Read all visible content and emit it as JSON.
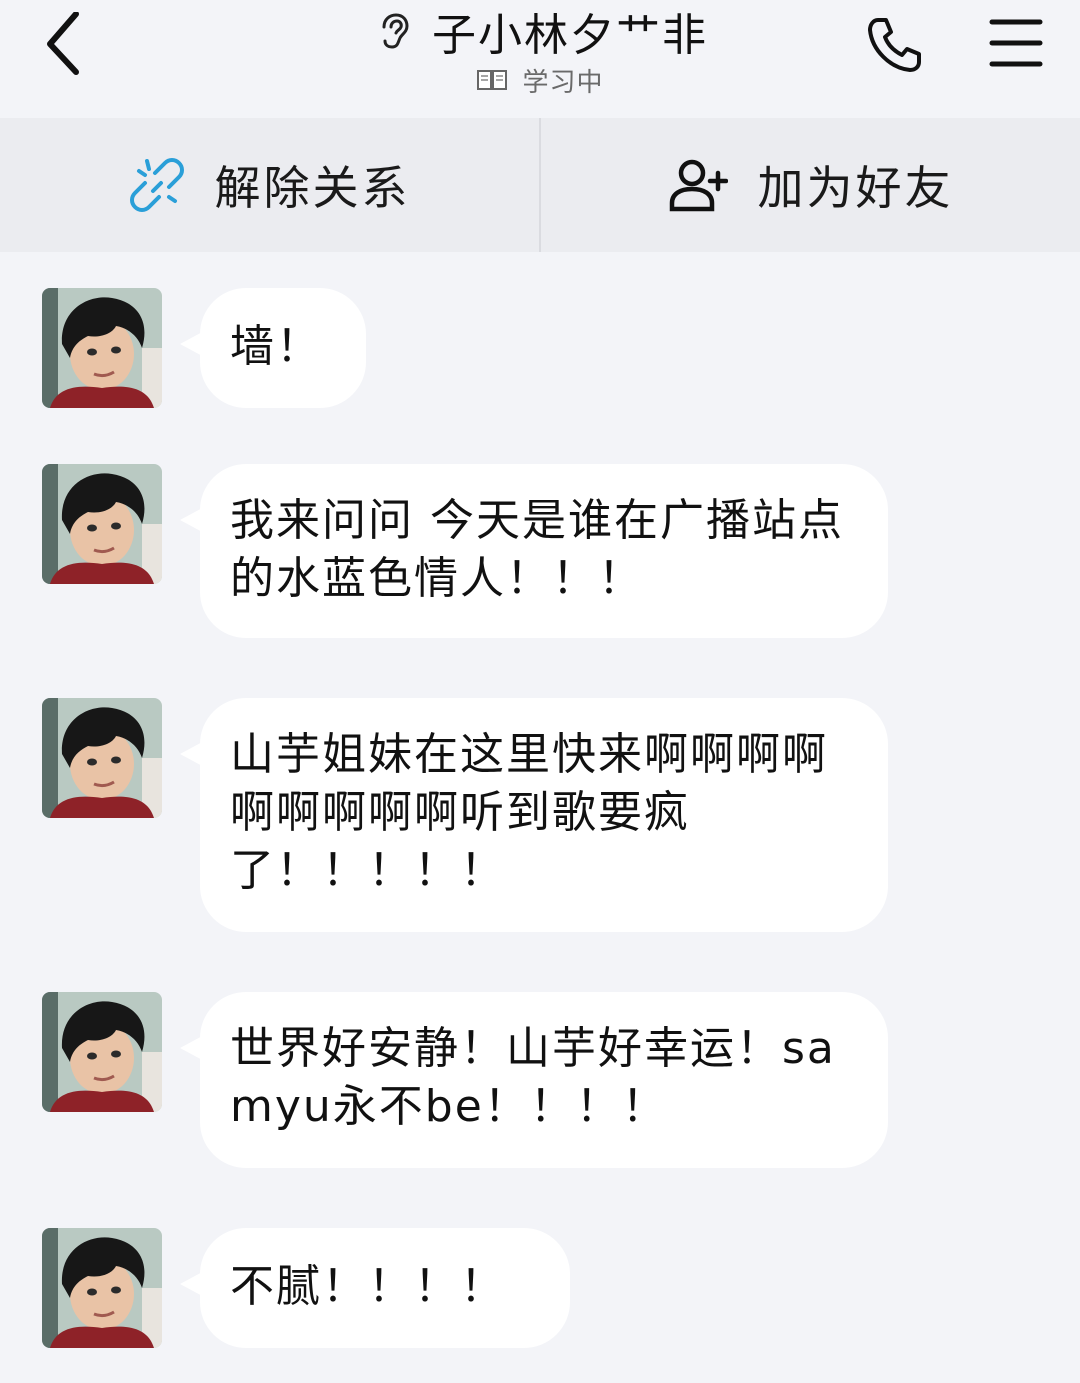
{
  "header": {
    "back_icon": "chevron-left-icon",
    "ear_icon": "ear-icon",
    "title": "子小林夕艹非",
    "status_icon": "book-icon",
    "status": "学习中",
    "phone_icon": "phone-icon",
    "menu_icon": "menu-icon"
  },
  "actions": {
    "unlink": {
      "icon": "unlink-icon",
      "label": "解除关系",
      "icon_color": "#2a9fd8"
    },
    "add_friend": {
      "icon": "add-user-icon",
      "label": "加为好友"
    }
  },
  "messages": [
    {
      "avatar": "avatar",
      "text": "墙！"
    },
    {
      "avatar": "avatar",
      "text": "我来问问 今天是谁在广播站点的水蓝色情人！！！"
    },
    {
      "avatar": "avatar",
      "text": "山芋姐妹在这里快来啊啊啊啊啊啊啊啊啊听到歌要疯了！！！！！"
    },
    {
      "avatar": "avatar",
      "text": "世界好安静！山芋好幸运！samyu永不be！！！！"
    },
    {
      "avatar": "avatar",
      "text": "不腻！！！！"
    }
  ],
  "colors": {
    "background": "#f3f4f8",
    "action_bar": "#ebecf0",
    "bubble": "#ffffff",
    "accent": "#2a9fd8"
  }
}
